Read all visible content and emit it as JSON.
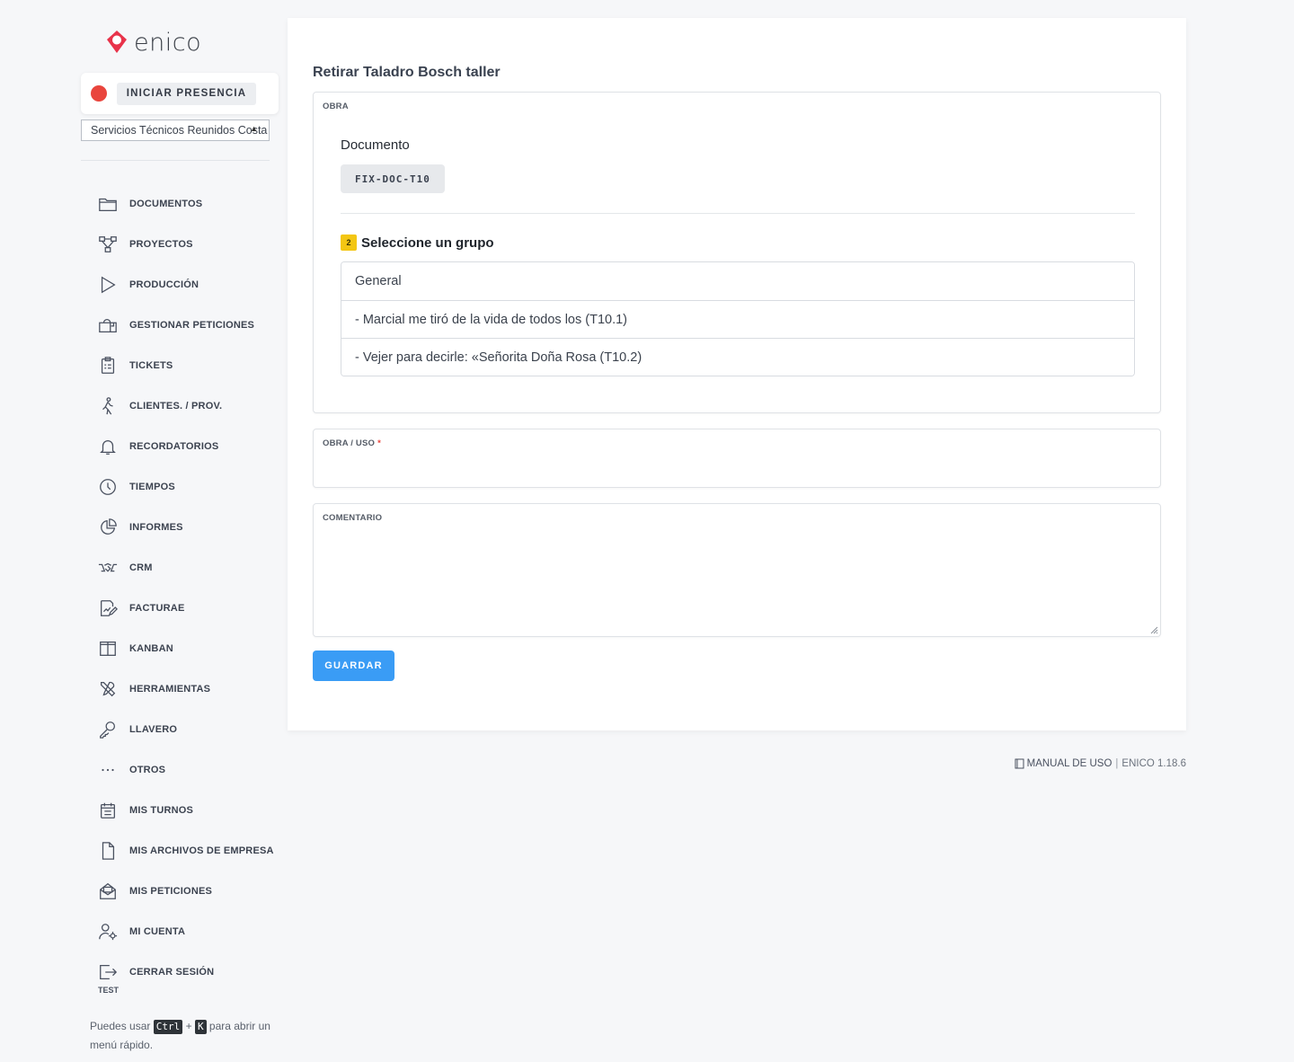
{
  "brand": {
    "name": "enico",
    "color": "#e8334a"
  },
  "presence": {
    "button_label": "INICIAR PRESENCIA",
    "status_color": "#e9453d"
  },
  "company_select": {
    "value": "Servicios Técnicos Reunidos Costa"
  },
  "nav": {
    "items": [
      {
        "label": "DOCUMENTOS",
        "icon": "folder-icon"
      },
      {
        "label": "PROYECTOS",
        "icon": "project-tree-icon"
      },
      {
        "label": "PRODUCCIÓN",
        "icon": "play-icon"
      },
      {
        "label": "GESTIONAR PETICIONES",
        "icon": "mailbox-icon"
      },
      {
        "label": "TICKETS",
        "icon": "clipboard-icon"
      },
      {
        "label": "CLIENTES. / PROV.",
        "icon": "walking-person-icon"
      },
      {
        "label": "RECORDATORIOS",
        "icon": "bell-icon"
      },
      {
        "label": "TIEMPOS",
        "icon": "clock-icon"
      },
      {
        "label": "INFORMES",
        "icon": "pie-chart-icon"
      },
      {
        "label": "CRM",
        "icon": "handshake-icon"
      },
      {
        "label": "FACTURAE",
        "icon": "invoice-edit-icon"
      },
      {
        "label": "KANBAN",
        "icon": "kanban-columns-icon"
      },
      {
        "label": "HERRAMIENTAS",
        "icon": "tools-icon"
      },
      {
        "label": "LLAVERO",
        "icon": "key-icon"
      },
      {
        "label": "OTROS",
        "icon": "more-dots-icon"
      },
      {
        "label": "MIS TURNOS",
        "icon": "calendar-icon"
      },
      {
        "label": "MIS ARCHIVOS DE EMPRESA",
        "icon": "file-icon"
      },
      {
        "label": "MIS PETICIONES",
        "icon": "envelope-open-icon"
      },
      {
        "label": "MI CUENTA",
        "icon": "user-gear-icon"
      },
      {
        "label": "CERRAR SESIÓN",
        "icon": "logout-icon",
        "sublabel": "TEST"
      }
    ]
  },
  "hint": {
    "prefix": "Puedes usar",
    "key1": "Ctrl",
    "plus": "+",
    "key2": "K",
    "suffix": "para abrir un menú rápido."
  },
  "main": {
    "title": "Retirar Taladro Bosch taller",
    "obra": {
      "legend": "OBRA",
      "doc_label": "Documento",
      "doc_code": "FIX-DOC-T10",
      "step_number": "2",
      "group_title": "Seleccione un grupo",
      "groups": [
        "General",
        "- Marcial me tiró de la vida de todos los (T10.1)",
        "- Vejer para decirle: «Señorita Doña Rosa (T10.2)"
      ]
    },
    "obra_uso": {
      "legend": "OBRA / USO",
      "required_mark": "*",
      "value": ""
    },
    "comentario": {
      "legend": "COMENTARIO",
      "value": ""
    },
    "save_label": "GUARDAR",
    "save_color": "#3a9cf5"
  },
  "footer": {
    "manual_label": "MANUAL DE USO",
    "separator": "|",
    "version": "ENICO 1.18.6"
  }
}
